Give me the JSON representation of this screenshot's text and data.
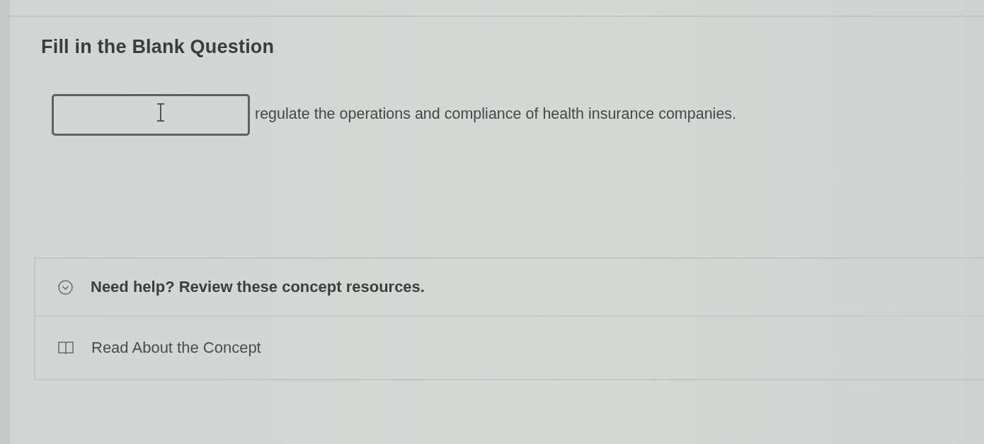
{
  "question": {
    "title": "Fill in the Blank Question",
    "sentence_after_blank": "regulate the operations and compliance of health insurance companies."
  },
  "help": {
    "label": "Need help? Review these concept resources.",
    "expanded": true,
    "resources": [
      {
        "label": "Read About the Concept"
      }
    ]
  }
}
